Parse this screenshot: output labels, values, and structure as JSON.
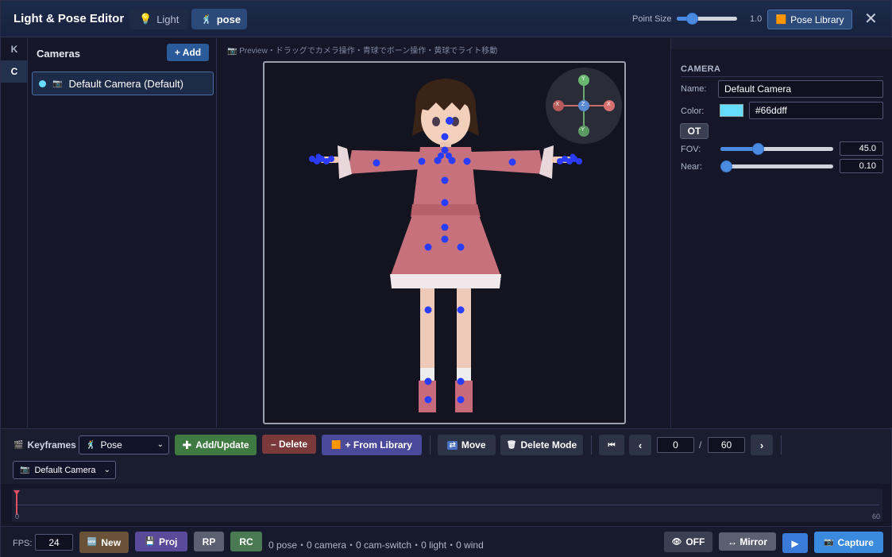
{
  "window": {
    "title": "Light & Pose Editor",
    "tabs": [
      {
        "label": "Light",
        "icon": "lightbulb-icon"
      },
      {
        "label": "pose",
        "icon": "figure-icon"
      }
    ],
    "point_size_label": "Point Size",
    "point_size_value": "1.0",
    "point_size_level": 0.25,
    "pose_library_label": "Pose Library",
    "close_symbol": "✕"
  },
  "rail": {
    "items": [
      "K",
      "C"
    ],
    "selected": "C"
  },
  "cameras": {
    "title": "Cameras",
    "add_label": "+ Add",
    "items": [
      {
        "name": "Default Camera (Default)",
        "color": "#66ddff"
      }
    ]
  },
  "preview": {
    "label": "Preview・ドラッグでカメラ操作・青球でボーン操作・黄球でライト移動",
    "gizmo": {
      "top": "Y",
      "bottom": "-Y",
      "left": "-X",
      "right": "X",
      "center": "Z"
    }
  },
  "camera_panel": {
    "section_title": "CAMERA",
    "name_label": "Name:",
    "name_value": "Default Camera",
    "color_label": "Color:",
    "color_value": "#66ddff",
    "ot_label": "OT",
    "fov_label": "FOV:",
    "fov_value": "45.0",
    "fov_level": 0.33,
    "near_label": "Near:",
    "near_value": "0.10",
    "near_level": 0.0
  },
  "keyframes": {
    "title": "Keyframes",
    "type_select": "Pose",
    "add_update": "Add/Update",
    "delete": "– Delete",
    "from_library": "+ From Library",
    "move": "Move",
    "delete_mode": "Delete Mode",
    "frame_current": "0",
    "frame_sep": "/",
    "frame_total": "60",
    "camera_select": "Default Camera"
  },
  "timeline": {
    "start": "0",
    "end": "60"
  },
  "footer": {
    "fps_label": "FPS:",
    "fps_value": "24",
    "new_label": "New",
    "proj_label": "Proj",
    "rp_label": "RP",
    "rc_label": "RC",
    "status": "0 pose・0 camera・0 cam-switch・0 light・0 wind",
    "off_label": "OFF",
    "mirror_label": "↔ Mirror",
    "play_symbol": "▶",
    "capture_label": "Capture"
  },
  "colors": {
    "accent": "#4a8ae0",
    "camera": "#66ddff",
    "add_green": "#3f7a42",
    "delete_red": "#7a3a3a",
    "library_purple": "#4a4a9a",
    "bone_dot": "#2a3cff"
  }
}
